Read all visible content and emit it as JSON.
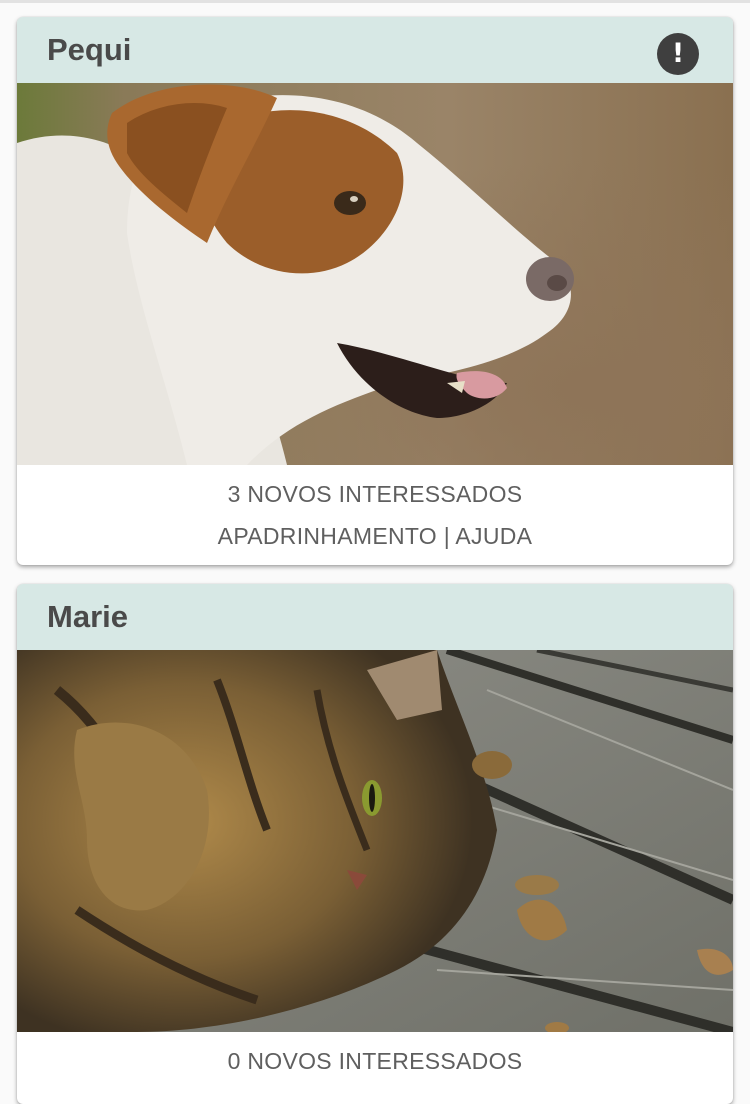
{
  "pets": [
    {
      "name": "Pequi",
      "alert_icon": "exclamation-icon",
      "interested_text": "3 NOVOS INTERESSADOS",
      "sponsorship_label": "APADRINHAMENTO",
      "separator": "|",
      "help_label": "AJUDA",
      "photo": "dog-photo"
    },
    {
      "name": "Marie",
      "interested_text": "0 NOVOS INTERESSADOS",
      "photo": "cat-photo"
    }
  ],
  "colors": {
    "card_header": "#d7e8e5",
    "title": "#4a4a4a",
    "footer_text": "#5f5f5f",
    "alert_bg": "#3f3f3f"
  }
}
